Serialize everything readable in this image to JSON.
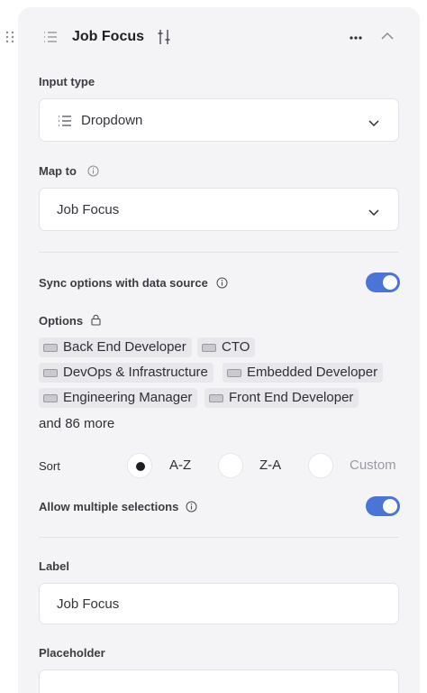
{
  "header": {
    "title": "Job Focus"
  },
  "input_type": {
    "label": "Input type",
    "value": "Dropdown"
  },
  "map_to": {
    "label": "Map to",
    "value": "Job Focus"
  },
  "sync": {
    "label": "Sync options with data source",
    "enabled": true
  },
  "options": {
    "label": "Options",
    "chips": [
      "Back End Developer",
      "CTO",
      "DevOps & Infrastructure",
      "Embedded Developer",
      "Engineering Manager",
      "Front End Developer"
    ],
    "more_text": "and 86 more"
  },
  "sort": {
    "label": "Sort",
    "choices": [
      "A-Z",
      "Z-A",
      "Custom"
    ],
    "selected": "A-Z"
  },
  "multi": {
    "label": "Allow multiple selections",
    "enabled": true
  },
  "label_field": {
    "label": "Label",
    "value": "Job Focus"
  },
  "placeholder_field": {
    "label": "Placeholder",
    "value": ""
  },
  "colors": {
    "accent": "#4a75d6",
    "panel": "#f4f4f6"
  },
  "icons": [
    "drag-handle-icon",
    "list-icon",
    "tune-icon",
    "more-horizontal-icon",
    "chevron-up-icon",
    "info-icon",
    "chevron-down-icon",
    "lock-icon",
    "keyboard-icon"
  ]
}
